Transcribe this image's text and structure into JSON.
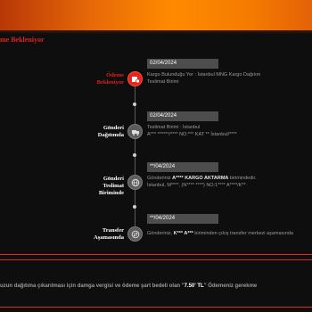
{
  "status_title": "me Bekleniyor",
  "steps": [
    {
      "label_line1": "Ödeme",
      "label_line2": "Bekleniyor",
      "label_line3": "",
      "date": "02/04/2024",
      "desc_line1": "Kargo Bulunduğu Yer : İstanbul MNG Kargo Dağıtım",
      "desc_line2": "Teslimat Birimi",
      "icon": "payment-icon"
    },
    {
      "label_line1": "Gönderi",
      "label_line2": "Dağıtımda",
      "label_line3": "",
      "date": "02/04/2024",
      "desc_line1": "Teslimat Birimi : İstanbul",
      "desc_line2": "A*** ******/**** NO:*** KAT ** İstanbul/****",
      "icon": "delivery-icon"
    },
    {
      "label_line1": "Gönderi",
      "label_line2": "Teslimat",
      "label_line3": "Biriminde",
      "date": "**/04/2024",
      "desc_pre": "Gönderiniz ",
      "desc_strong": "A**** KARGO AKTARMA",
      "desc_post": " birimindedir.",
      "desc_line2": "İstanbul, M****, (N**** ****) NO:1**** A****/K**",
      "icon": "globe-icon"
    },
    {
      "label_line1": "Transfer",
      "label_line2": "Aşamasında",
      "label_line3": "",
      "date": "**/04/2024",
      "desc_pre": "Gönderiniz, ",
      "desc_strong": "K*** A***",
      "desc_post": " biriminden çıkış transfer merkezi aşamasında",
      "desc_line2": "",
      "icon": "transfer-icon"
    }
  ],
  "bottom_note": {
    "pre": "uzun dağıtıma çıkarılması için damga vergisi ve ödeme şart bedeli olan \"",
    "fee": "7.50' TL",
    "post": "\" Ödemeniz gerekme"
  },
  "colors": {
    "accent": "#ff8a00",
    "active": "#e5241c",
    "stripe": "#e8251a"
  }
}
